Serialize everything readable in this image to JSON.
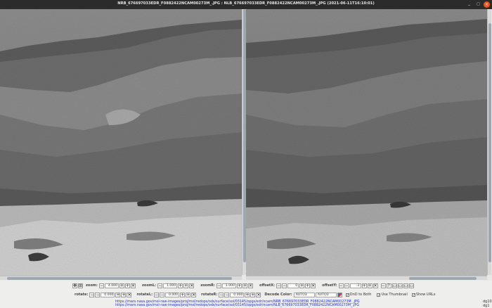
{
  "window": {
    "title": "NRB_676697033EDR_F0882422NCAM00273M_.JPG : NLB_676697033EDR_F0882422NCAM00273M_.JPG (2021-06-11T16:10:01)",
    "min_glyph": "_",
    "max_glyph": "□",
    "close_glyph": "×"
  },
  "controls": {
    "zoom_label": "zoom:",
    "zoom_value": "4.000",
    "zoomL_label": "zoomL:",
    "zoomL_value": "1.000",
    "zoomR_label": "zoomR:",
    "zoomR_value": "1.000",
    "offsetX_label": "offsetX:",
    "offsetX_value": "0",
    "offsetY_label": "offsetY:",
    "offsetY_value": "-3",
    "rotate_label": "rotate:",
    "rotate_value": "0.000",
    "rotateL_label": "rotateL:",
    "rotateL_value": "0.000",
    "rotateR_label": "rotateR:",
    "rotateR_value": "0.000",
    "decode_color_label": "Decode Color:",
    "decode_left": "AUTO3",
    "decode_right": "AUTO3",
    "dnd_label": "DnD to Both",
    "dnd_checked": "✓",
    "thumbnail_label": "Use Thumbnail",
    "thumbnail_checked": "✓",
    "show_urls_label": "Show URLs",
    "show_urls_checked": "✓",
    "minus": "−",
    "plus": "+",
    "reset": "✕",
    "help": "?"
  },
  "urls": {
    "left": "https://mars.nasa.gov/msl-raw-images/proj/msl/redops/ods/surface/sol/03145/opgs/edr/ncam/NRB_676697033EDR_F0882422NCAM00273M_.JPG",
    "right": "https://mars.nasa.gov/msl-raw-images/proj/msl/redops/ods/surface/sol/03145/opgs/edr/ncam/NLB_676697033EDR_F0882422NCAM00273M_.JPG"
  },
  "corner": {
    "line1": "dg10",
    "line2": "dg1"
  }
}
